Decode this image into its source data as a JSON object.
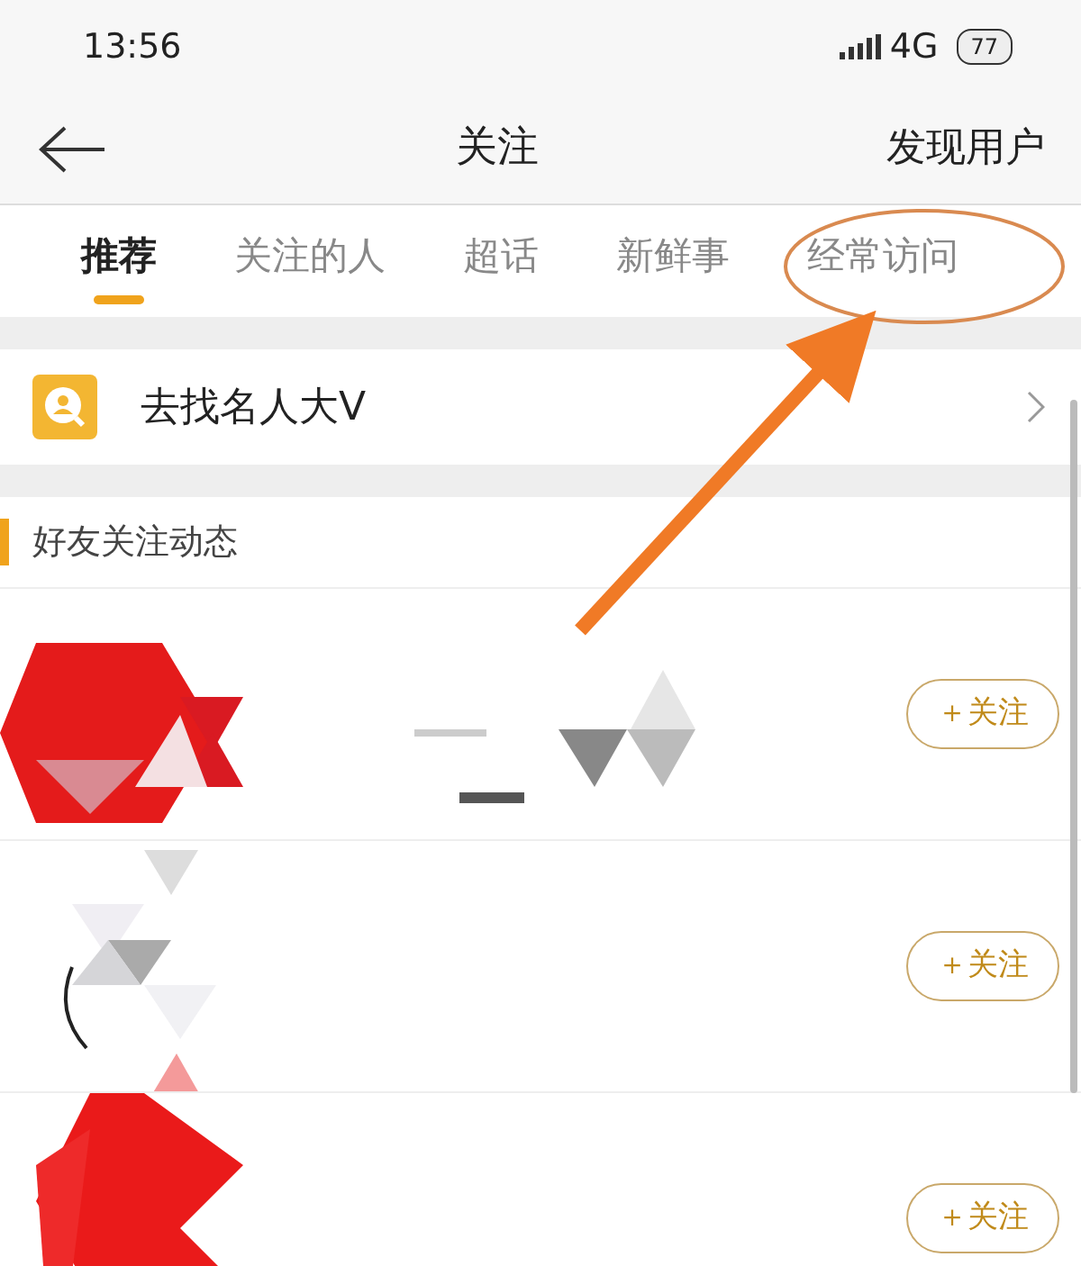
{
  "status_bar": {
    "time": "13:56",
    "network": "4G",
    "battery": "77"
  },
  "header": {
    "title": "关注",
    "action": "发现用户"
  },
  "tabs": [
    {
      "label": "推荐",
      "selected": true
    },
    {
      "label": "关注的人",
      "selected": false
    },
    {
      "label": "超话",
      "selected": false
    },
    {
      "label": "新鲜事",
      "selected": false
    },
    {
      "label": "经常访问",
      "selected": false
    }
  ],
  "find_row": {
    "label": "去找名人大V"
  },
  "section": {
    "title": "好友关注动态"
  },
  "users": [
    {
      "kind": "picture",
      "button": "＋关注"
    },
    {
      "kind": "picture",
      "button": "＋关注"
    },
    {
      "kind": "picture",
      "button": "＋关注"
    }
  ]
}
